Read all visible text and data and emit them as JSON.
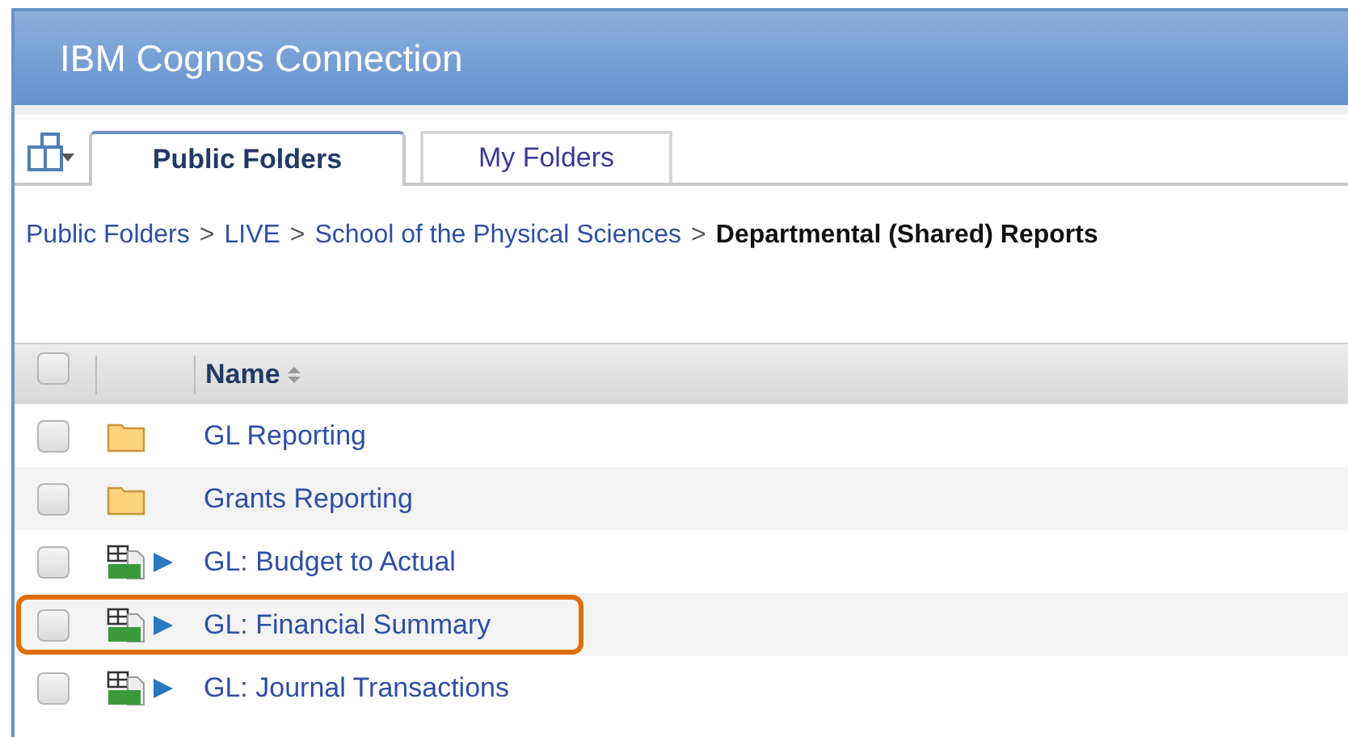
{
  "window": {
    "title": "IBM Cognos Connection"
  },
  "tabs": [
    {
      "label": "Public Folders",
      "selected": true
    },
    {
      "label": "My Folders",
      "selected": false
    }
  ],
  "breadcrumb": [
    {
      "kind": "link",
      "label": "Public Folders"
    },
    {
      "kind": "separator",
      "label": ">"
    },
    {
      "kind": "link",
      "label": "LIVE"
    },
    {
      "kind": "separator",
      "label": ">"
    },
    {
      "kind": "link",
      "label": "School of the Physical Sciences"
    },
    {
      "kind": "separator",
      "label": ">"
    },
    {
      "kind": "current",
      "label": "Departmental (Shared) Reports"
    }
  ],
  "table": {
    "columns": [
      {
        "label": "Name",
        "sortable": true
      }
    ],
    "select_all": {
      "checked": false
    },
    "rows": [
      {
        "kind": "folder",
        "name": "GL Reporting",
        "checked": false,
        "highlighted": false
      },
      {
        "kind": "folder",
        "name": "Grants Reporting",
        "checked": false,
        "highlighted": false
      },
      {
        "kind": "report",
        "name": "GL: Budget to Actual",
        "checked": false,
        "highlighted": false
      },
      {
        "kind": "report",
        "name": "GL: Financial Summary",
        "checked": false,
        "highlighted": true
      },
      {
        "kind": "report",
        "name": "GL: Journal Transactions",
        "checked": false,
        "highlighted": false
      }
    ]
  }
}
